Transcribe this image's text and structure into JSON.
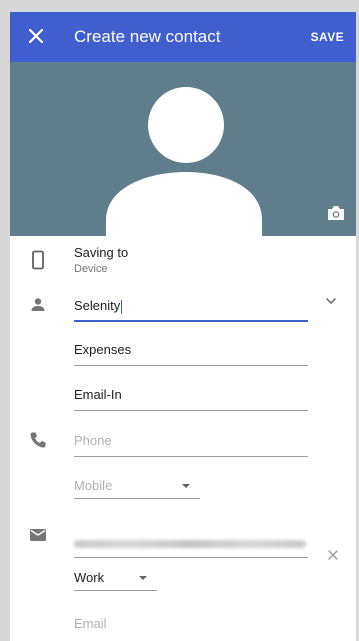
{
  "app_bar": {
    "title": "Create new contact",
    "save_label": "SAVE",
    "close_icon": "close-icon"
  },
  "saving_to": {
    "label": "Saving to",
    "value": "Device"
  },
  "name": {
    "value": "Selenity"
  },
  "company": {
    "value": "Expenses"
  },
  "title_field": {
    "value": "Email-In"
  },
  "phone": {
    "placeholder": "Phone",
    "type": "Mobile"
  },
  "email": {
    "type": "Work",
    "placeholder": "Email"
  },
  "colors": {
    "app_bar": "#3f5fcf",
    "photo_bg": "#607d8b",
    "active_underline": "#3f5fcf"
  }
}
